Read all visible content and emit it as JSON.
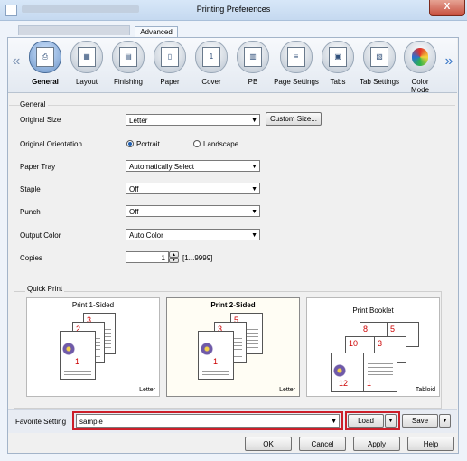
{
  "window": {
    "title": "Printing Preferences",
    "close_glyph": "X"
  },
  "tabs": {
    "advanced": "Advanced"
  },
  "ribbon": {
    "items": [
      {
        "label": "General",
        "glyph": "⎙"
      },
      {
        "label": "Layout",
        "glyph": "▦"
      },
      {
        "label": "Finishing",
        "glyph": "▤"
      },
      {
        "label": "Paper",
        "glyph": "▯"
      },
      {
        "label": "Cover",
        "glyph": "1"
      },
      {
        "label": "PB",
        "glyph": "▥"
      },
      {
        "label": "Page Settings",
        "glyph": "≡"
      },
      {
        "label": "Tabs",
        "glyph": "▣"
      },
      {
        "label": "Tab Settings",
        "glyph": "▧"
      },
      {
        "label": "Color\nMode",
        "glyph": "●"
      }
    ],
    "left_arrow": "«",
    "right_arrow": "»"
  },
  "general": {
    "legend": "General",
    "original_size": {
      "label": "Original Size",
      "value": "Letter",
      "custom_button": "Custom Size..."
    },
    "orientation": {
      "label": "Original Orientation",
      "portrait": "Portrait",
      "landscape": "Landscape",
      "selected": "Portrait"
    },
    "paper_tray": {
      "label": "Paper Tray",
      "value": "Automatically Select"
    },
    "staple": {
      "label": "Staple",
      "value": "Off"
    },
    "punch": {
      "label": "Punch",
      "value": "Off"
    },
    "output_color": {
      "label": "Output Color",
      "value": "Auto Color"
    },
    "copies": {
      "label": "Copies",
      "value": "1",
      "range": "[1...9999]"
    }
  },
  "quick_print": {
    "legend": "Quick Print",
    "cards": [
      {
        "title": "Print 1-Sided",
        "size": "Letter",
        "pages": [
          "3",
          "2",
          "1"
        ]
      },
      {
        "title": "Print 2-Sided",
        "size": "Letter",
        "pages": [
          "5",
          "3",
          "1"
        ]
      },
      {
        "title": "Print Booklet",
        "size": "Tabloid",
        "pages": [
          "8",
          "5",
          "10",
          "3",
          "12",
          "1"
        ]
      }
    ]
  },
  "favorite": {
    "label": "Favorite Setting",
    "value": "sample",
    "load_button": "Load",
    "save_button": "Save"
  },
  "footer": {
    "ok": "OK",
    "cancel": "Cancel",
    "apply": "Apply",
    "help": "Help"
  }
}
